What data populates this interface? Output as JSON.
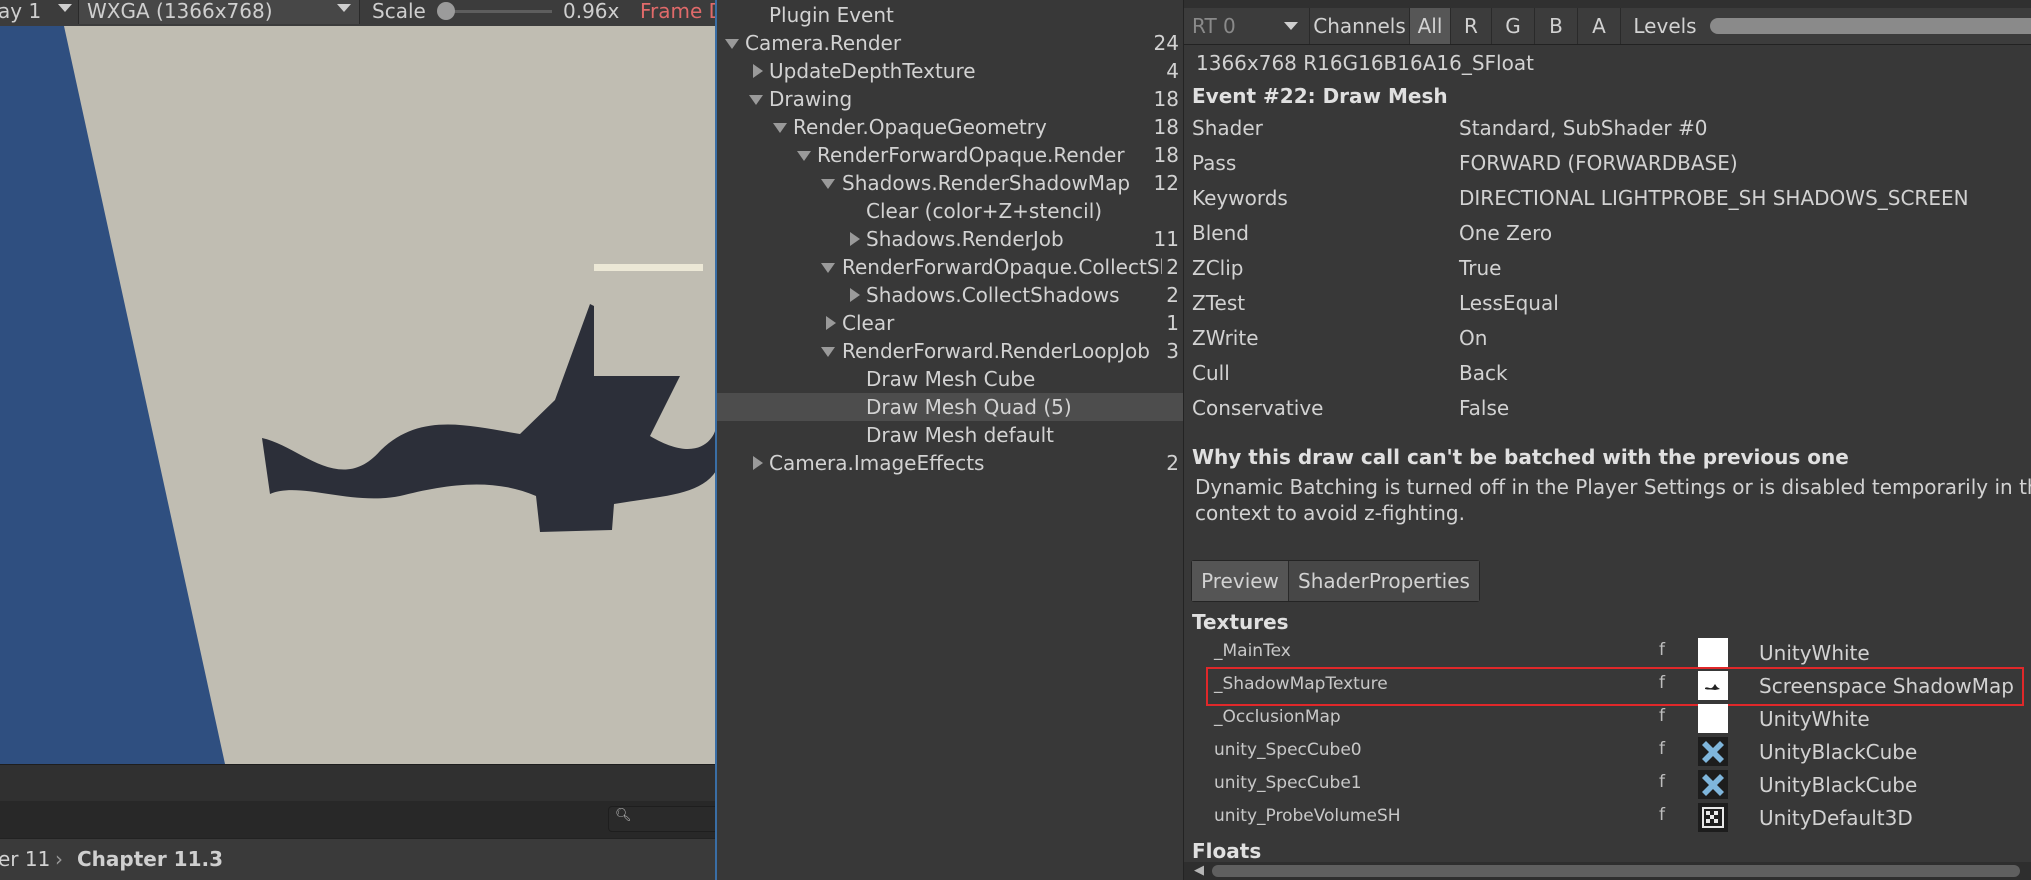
{
  "game_view": {
    "display_label": "ay 1",
    "resolution": "WXGA (1366x768)",
    "scale_label": "Scale",
    "scale_value": "0.96x",
    "scale_level": 0.0,
    "frame_label": "Frame D",
    "breadcrumb": [
      "er 11",
      "Chapter 11.3"
    ]
  },
  "tree": {
    "rows": [
      {
        "label": "Plugin Event",
        "count": ""
      },
      {
        "label": "Camera.Render",
        "count": "24"
      },
      {
        "label": "UpdateDepthTexture",
        "count": "4"
      },
      {
        "label": "Drawing",
        "count": "18"
      },
      {
        "label": "Render.OpaqueGeometry",
        "count": "18"
      },
      {
        "label": "RenderForwardOpaque.Render",
        "count": "18"
      },
      {
        "label": "Shadows.RenderShadowMap",
        "count": "12"
      },
      {
        "label": "Clear (color+Z+stencil)",
        "count": ""
      },
      {
        "label": "Shadows.RenderJob",
        "count": "11"
      },
      {
        "label": "RenderForwardOpaque.CollectSh",
        "count": "2"
      },
      {
        "label": "Shadows.CollectShadows",
        "count": "2"
      },
      {
        "label": "Clear",
        "count": "1"
      },
      {
        "label": "RenderForward.RenderLoopJob",
        "count": "3"
      },
      {
        "label": "Draw Mesh Cube",
        "count": ""
      },
      {
        "label": "Draw Mesh Quad (5)",
        "count": ""
      },
      {
        "label": "Draw Mesh default",
        "count": ""
      },
      {
        "label": "Camera.ImageEffects",
        "count": "2"
      }
    ]
  },
  "inspector": {
    "rt_select": "RT 0",
    "channels_label": "Channels",
    "channel_buttons": [
      "All",
      "R",
      "G",
      "B",
      "A"
    ],
    "levels_label": "Levels",
    "format": "1366x768 R16G16B16A16_SFloat",
    "event_title": "Event #22: Draw Mesh",
    "properties": [
      {
        "key": "Shader",
        "value": "Standard, SubShader #0"
      },
      {
        "key": "Pass",
        "value": "FORWARD (FORWARDBASE)"
      },
      {
        "key": "Keywords",
        "value": "DIRECTIONAL LIGHTPROBE_SH SHADOWS_SCREEN"
      },
      {
        "key": "Blend",
        "value": "One Zero"
      },
      {
        "key": "ZClip",
        "value": "True"
      },
      {
        "key": "ZTest",
        "value": "LessEqual"
      },
      {
        "key": "ZWrite",
        "value": "On"
      },
      {
        "key": "Cull",
        "value": "Back"
      },
      {
        "key": "Conservative",
        "value": "False"
      }
    ],
    "batch_title": "Why this draw call can't be batched with the previous one",
    "batch_text_line1": "Dynamic Batching is turned off in the Player Settings or is disabled temporarily in the cu",
    "batch_text_line2": "context to avoid z-fighting.",
    "tabs": [
      "Preview",
      "ShaderProperties"
    ],
    "textures_header": "Textures",
    "textures": [
      {
        "name": "_MainTex",
        "flag": "f",
        "value": "UnityWhite",
        "thumb": "white"
      },
      {
        "name": "_ShadowMapTexture",
        "flag": "f",
        "value": "Screenspace ShadowMap",
        "thumb": "shadowmap"
      },
      {
        "name": "_OcclusionMap",
        "flag": "f",
        "value": "UnityWhite",
        "thumb": "white"
      },
      {
        "name": "unity_SpecCube0",
        "flag": "f",
        "value": "UnityBlackCube",
        "thumb": "cube"
      },
      {
        "name": "unity_SpecCube1",
        "flag": "f",
        "value": "UnityBlackCube",
        "thumb": "cube"
      },
      {
        "name": "unity_ProbeVolumeSH",
        "flag": "f",
        "value": "UnityDefault3D",
        "thumb": "3d"
      }
    ],
    "floats_header": "Floats"
  },
  "colors": {
    "highlight_box": "#e0282a",
    "frame_debug_text": "#e06a6a",
    "divider": "#3a6ea5"
  }
}
